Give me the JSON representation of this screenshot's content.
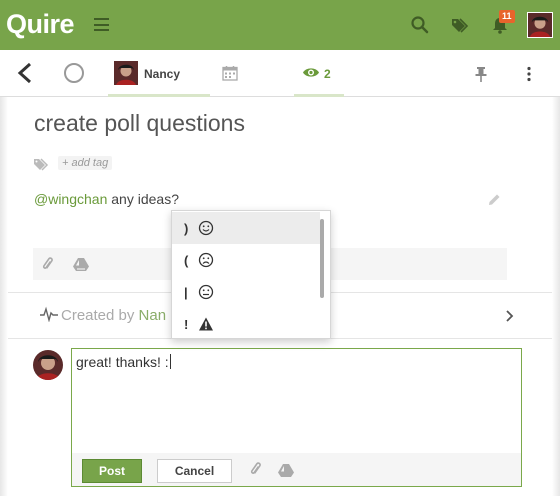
{
  "app": {
    "logo": "Quire",
    "notification_count": "11"
  },
  "toolbar": {
    "assignee_name": "Nancy",
    "watchers_count": "2"
  },
  "task": {
    "title": "create poll questions",
    "add_tag_label": "+ add tag",
    "description_mention": "@wingchan",
    "description_text": " any ideas?"
  },
  "activity": {
    "prefix": "Created by ",
    "name": "Nan"
  },
  "comment": {
    "text": "great! thanks! :",
    "post_label": "Post",
    "cancel_label": "Cancel"
  },
  "emoji_popup": {
    "items": [
      {
        "key": ")",
        "emoji": "smile",
        "selected": true
      },
      {
        "key": "(",
        "emoji": "frown",
        "selected": false
      },
      {
        "key": "|",
        "emoji": "neutral",
        "selected": false
      },
      {
        "key": "!",
        "emoji": "warning",
        "selected": false
      }
    ]
  },
  "colors": {
    "brand": "#78a44a",
    "accent_text": "#6a9a3a",
    "badge": "#e8642c"
  }
}
